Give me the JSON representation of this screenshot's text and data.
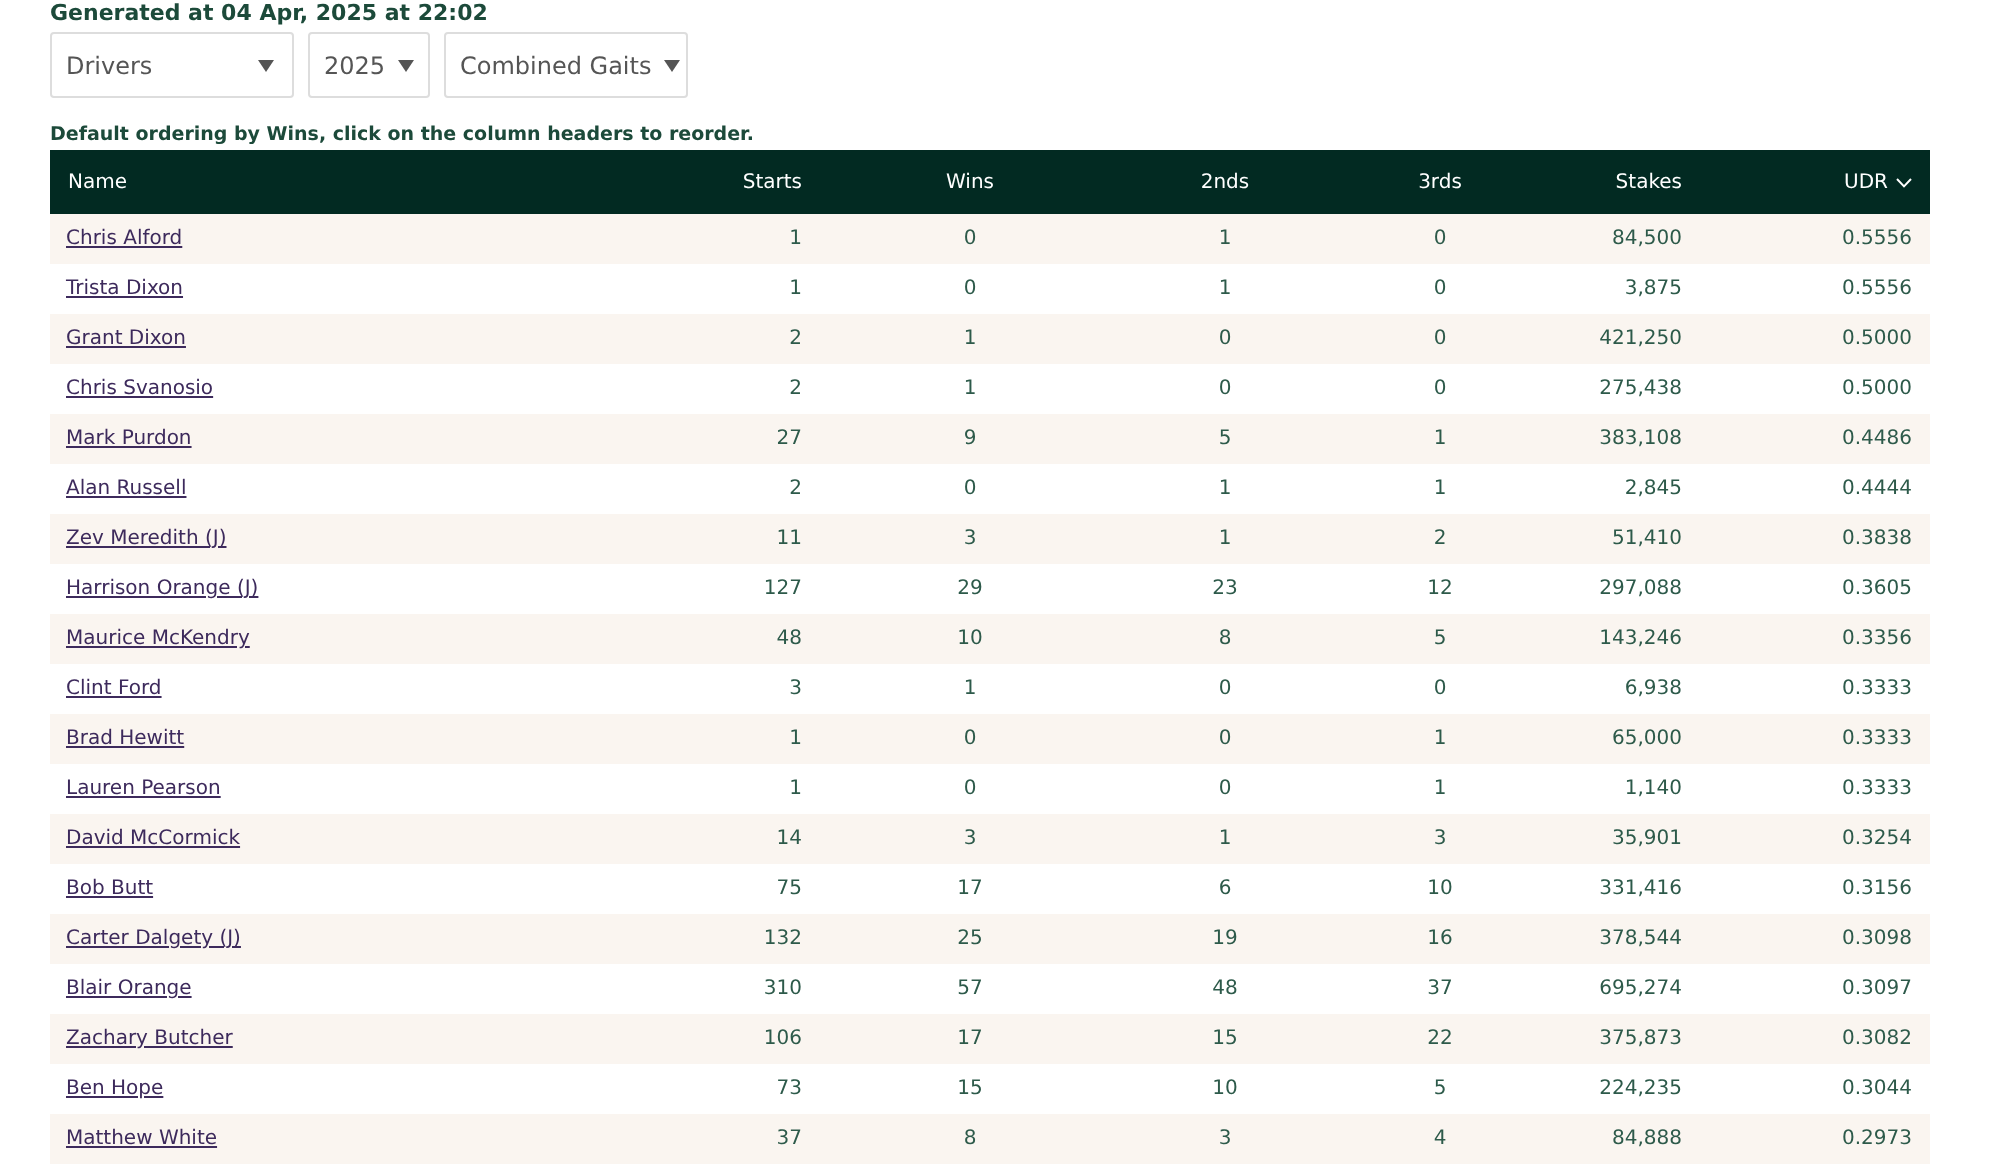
{
  "generated": "Generated at 04 Apr, 2025 at 22:02",
  "filters": [
    {
      "value": "Drivers"
    },
    {
      "value": "2025"
    },
    {
      "value": "Combined Gaits"
    }
  ],
  "caption": "Default ordering by Wins, click on the column headers to reorder.",
  "table": {
    "columns": [
      {
        "label": "Name",
        "sorted": false
      },
      {
        "label": "Starts",
        "sorted": false
      },
      {
        "label": "Wins",
        "sorted": false
      },
      {
        "label": "2nds",
        "sorted": false
      },
      {
        "label": "3rds",
        "sorted": false
      },
      {
        "label": "Stakes",
        "sorted": false
      },
      {
        "label": "UDR",
        "sorted": true
      }
    ],
    "rows": [
      [
        "Chris Alford",
        "1",
        "0",
        "1",
        "0",
        "84,500",
        "0.5556"
      ],
      [
        "Trista Dixon",
        "1",
        "0",
        "1",
        "0",
        "3,875",
        "0.5556"
      ],
      [
        "Grant Dixon",
        "2",
        "1",
        "0",
        "0",
        "421,250",
        "0.5000"
      ],
      [
        "Chris Svanosio",
        "2",
        "1",
        "0",
        "0",
        "275,438",
        "0.5000"
      ],
      [
        "Mark Purdon",
        "27",
        "9",
        "5",
        "1",
        "383,108",
        "0.4486"
      ],
      [
        "Alan Russell",
        "2",
        "0",
        "1",
        "1",
        "2,845",
        "0.4444"
      ],
      [
        "Zev Meredith (J)",
        "11",
        "3",
        "1",
        "2",
        "51,410",
        "0.3838"
      ],
      [
        "Harrison Orange (J)",
        "127",
        "29",
        "23",
        "12",
        "297,088",
        "0.3605"
      ],
      [
        "Maurice McKendry",
        "48",
        "10",
        "8",
        "5",
        "143,246",
        "0.3356"
      ],
      [
        "Clint Ford",
        "3",
        "1",
        "0",
        "0",
        "6,938",
        "0.3333"
      ],
      [
        "Brad Hewitt",
        "1",
        "0",
        "0",
        "1",
        "65,000",
        "0.3333"
      ],
      [
        "Lauren Pearson",
        "1",
        "0",
        "0",
        "1",
        "1,140",
        "0.3333"
      ],
      [
        "David McCormick",
        "14",
        "3",
        "1",
        "3",
        "35,901",
        "0.3254"
      ],
      [
        "Bob Butt",
        "75",
        "17",
        "6",
        "10",
        "331,416",
        "0.3156"
      ],
      [
        "Carter Dalgety (J)",
        "132",
        "25",
        "19",
        "16",
        "378,544",
        "0.3098"
      ],
      [
        "Blair Orange",
        "310",
        "57",
        "48",
        "37",
        "695,274",
        "0.3097"
      ],
      [
        "Zachary Butcher",
        "106",
        "17",
        "15",
        "22",
        "375,873",
        "0.3082"
      ],
      [
        "Ben Hope",
        "73",
        "15",
        "10",
        "5",
        "224,235",
        "0.3044"
      ],
      [
        "Matthew White",
        "37",
        "8",
        "3",
        "4",
        "84,888",
        "0.2973"
      ]
    ]
  }
}
